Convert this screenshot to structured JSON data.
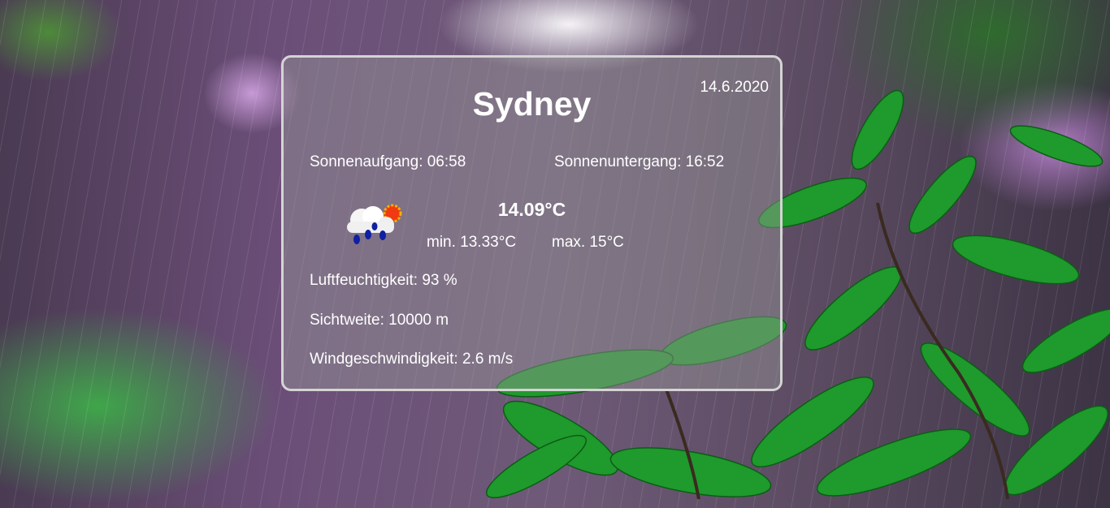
{
  "city": "Sydney",
  "date": "14.6.2020",
  "sunrise": "Sonnenaufgang: 06:58",
  "sunset": "Sonnenuntergang: 16:52",
  "weather_icon": "cloud-sun-rain-icon",
  "temperature": "14.09°C",
  "min": "min. 13.33°C",
  "max": "max. 15°C",
  "humidity": "Luftfeuchtigkeit: 93 %",
  "visibility": "Sichtweite: 10000 m",
  "wind": "Windgeschwindigkeit: 2.6 m/s"
}
